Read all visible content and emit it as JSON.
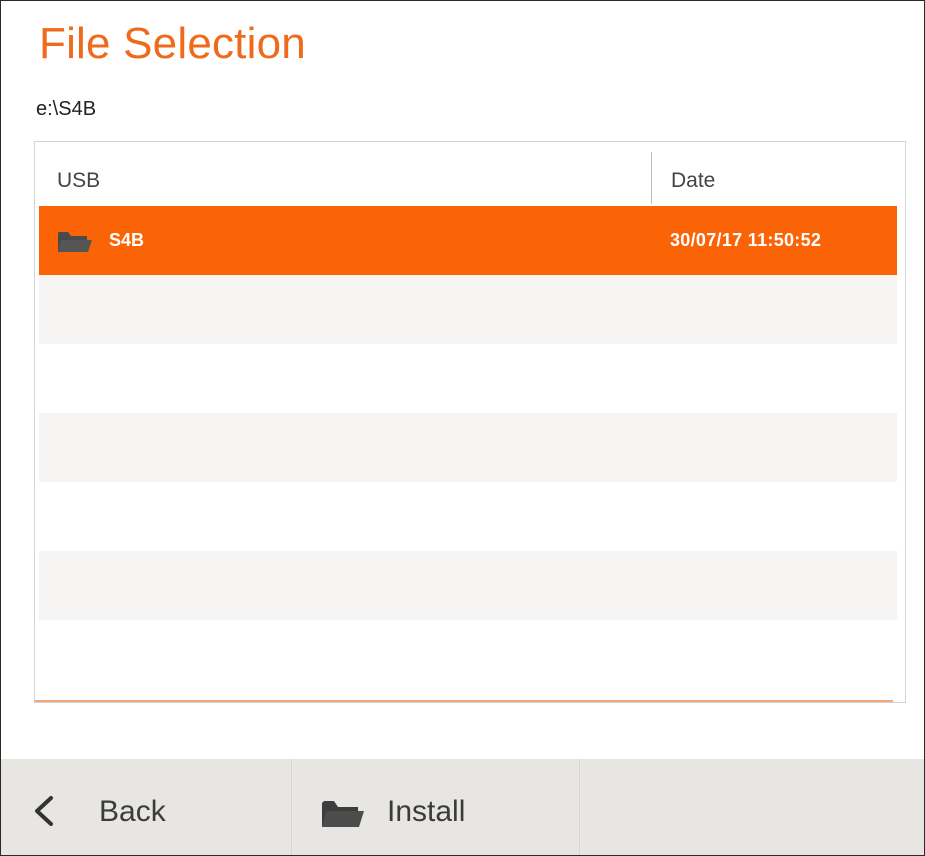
{
  "page": {
    "title": "File Selection",
    "path": "e:\\S4B"
  },
  "table": {
    "columns": [
      "USB",
      "Date"
    ],
    "rows": [
      {
        "icon": "folder-icon",
        "name": "S4B",
        "date": "30/07/17  11:50:52",
        "selected": true
      }
    ]
  },
  "footer": {
    "back_label": "Back",
    "install_label": "Install"
  },
  "colors": {
    "accent": "#f06a1c",
    "selection": "#fb6406",
    "footer_bg": "#e7e6e3"
  }
}
